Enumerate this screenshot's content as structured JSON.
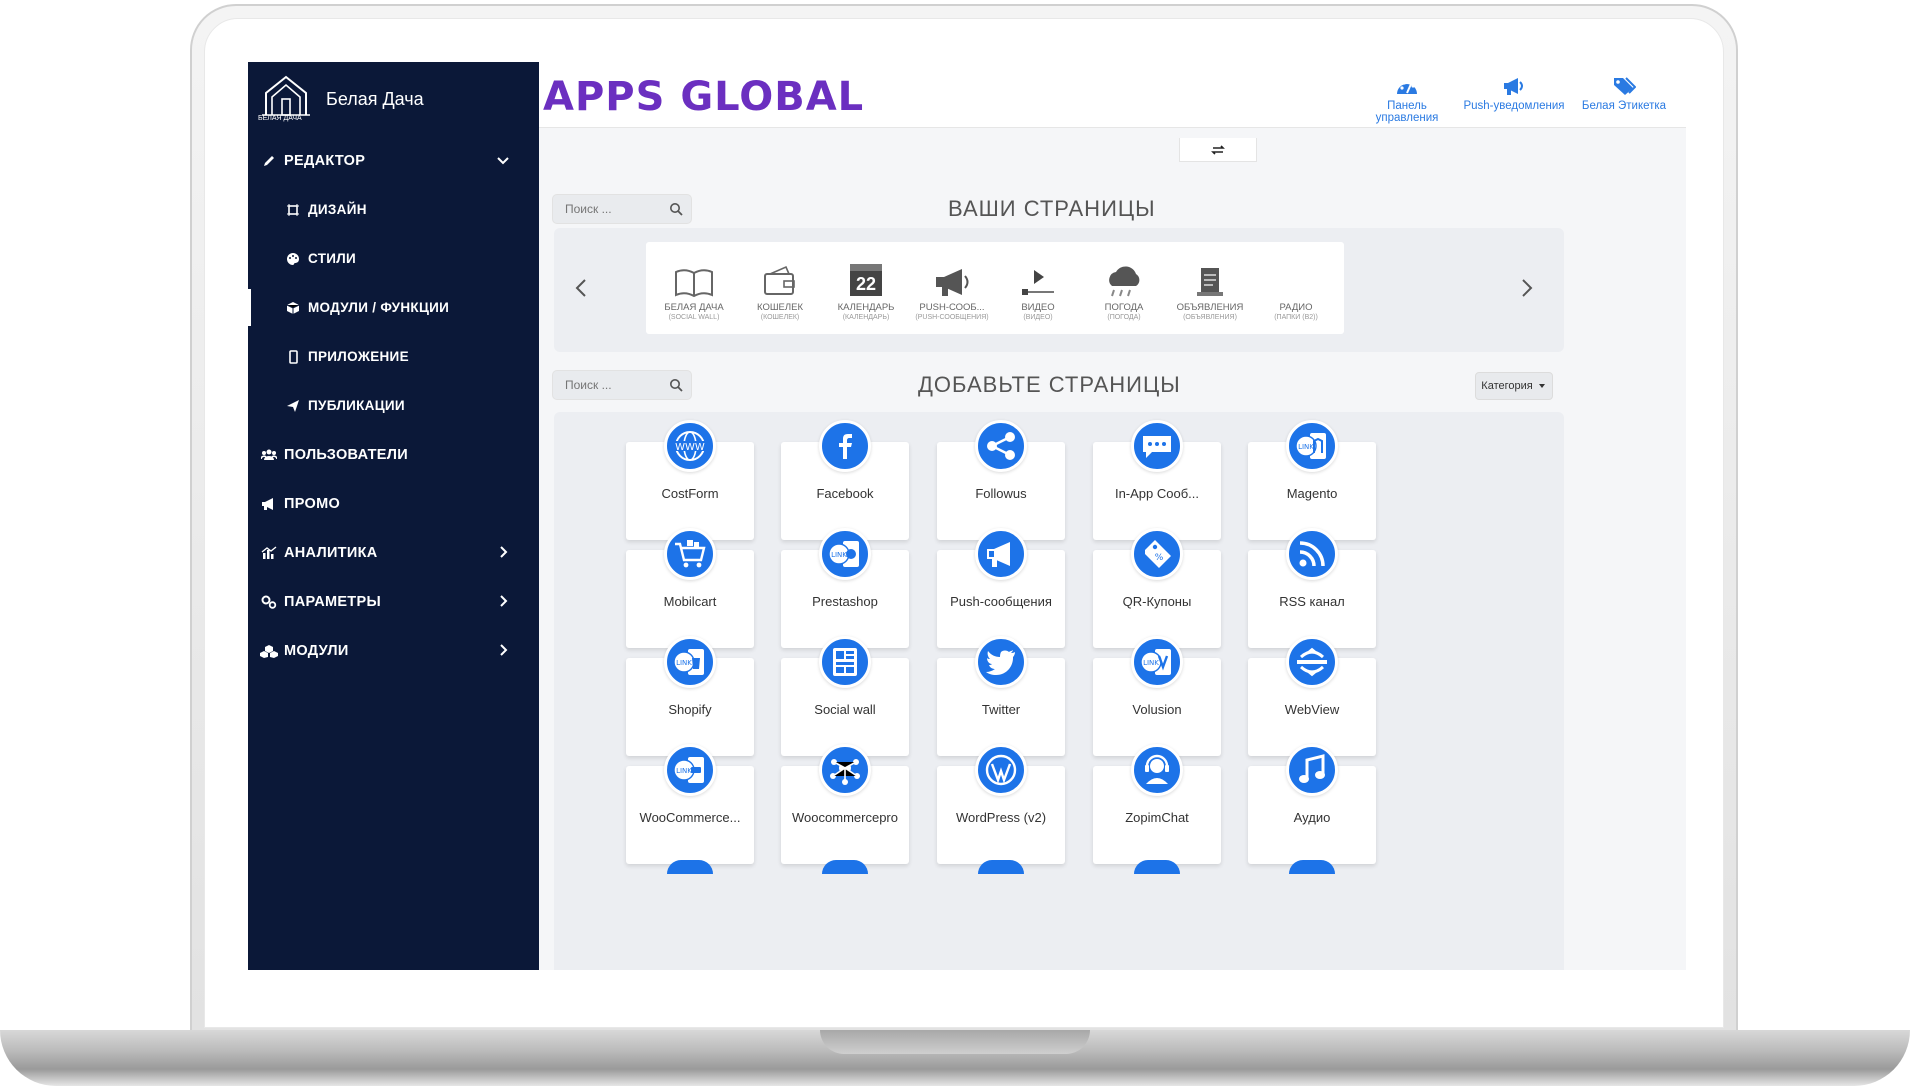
{
  "brand": {
    "name": "Белая Дача",
    "logo_sub": "БЕЛАЯ ДАЧА"
  },
  "sidebar": {
    "items": [
      {
        "label": "РЕДАКТОР",
        "icon": "pencil-icon",
        "level": 0,
        "chevron": "down"
      },
      {
        "label": "ДИЗАЙН",
        "icon": "design-icon",
        "level": 1
      },
      {
        "label": "СТИЛИ",
        "icon": "palette-icon",
        "level": 1
      },
      {
        "label": "МОДУЛИ / ФУНКЦИИ",
        "icon": "cube-icon",
        "level": 1,
        "active": true
      },
      {
        "label": "ПРИЛОЖЕНИЕ",
        "icon": "phone-icon",
        "level": 1
      },
      {
        "label": "ПУБЛИКАЦИИ",
        "icon": "send-icon",
        "level": 1
      },
      {
        "label": "ПОЛЬЗОВАТЕЛИ",
        "icon": "users-icon",
        "level": 0
      },
      {
        "label": "ПРОМО",
        "icon": "megaphone-icon",
        "level": 0
      },
      {
        "label": "АНАЛИТИКА",
        "icon": "chart-icon",
        "level": 0,
        "chevron": "right"
      },
      {
        "label": "ПАРАМЕТРЫ",
        "icon": "gears-icon",
        "level": 0,
        "chevron": "right"
      },
      {
        "label": "МОДУЛИ",
        "icon": "cubes-icon",
        "level": 0,
        "chevron": "right"
      }
    ]
  },
  "topbar": {
    "logo": "APPS GLOBAL",
    "actions": [
      {
        "label": "Панель управления",
        "icon": "dashboard-icon"
      },
      {
        "label": "Push-уведомления",
        "icon": "megaphone-icon"
      },
      {
        "label": "Белая Этикетка",
        "icon": "tags-icon"
      }
    ]
  },
  "your_pages": {
    "title": "ВАШИ СТРАНИЦЫ",
    "search_placeholder": "Поиск ...",
    "pages": [
      {
        "label": "БЕЛАЯ ДАЧА",
        "sub": "(SOCIAL WALL)",
        "icon": "book-icon"
      },
      {
        "label": "КОШЕЛЕК",
        "sub": "(КОШЕЛЕК)",
        "icon": "wallet-icon"
      },
      {
        "label": "КАЛЕНДАРЬ",
        "sub": "(КАЛЕНДАРЬ)",
        "icon": "calendar-icon",
        "calendar_day": "22"
      },
      {
        "label": "PUSH-СООБ...",
        "sub": "(PUSH-СООБЩЕНИЯ)",
        "icon": "megaphone-icon"
      },
      {
        "label": "ВИДЕО",
        "sub": "(ВИДЕО)",
        "icon": "video-icon"
      },
      {
        "label": "ПОГОДА",
        "sub": "(ПОГОДА)",
        "icon": "weather-icon"
      },
      {
        "label": "ОБЪЯВЛЕНИЯ",
        "sub": "(ОБЪЯВЛЕНИЯ)",
        "icon": "note-icon"
      },
      {
        "label": "РАДИО",
        "sub": "(ПАПКИ (B2))",
        "icon": "radio-icon"
      }
    ]
  },
  "add_pages": {
    "title": "ДОБАВЬТЕ СТРАНИЦЫ",
    "search_placeholder": "Поиск ...",
    "category_label": "Категория",
    "modules": [
      {
        "label": "CostForm",
        "icon": "www-icon"
      },
      {
        "label": "Facebook",
        "icon": "facebook-icon"
      },
      {
        "label": "Followus",
        "icon": "share-icon"
      },
      {
        "label": "In-App Cooб...",
        "icon": "chat-icon"
      },
      {
        "label": "Magento",
        "icon": "magento-icon"
      },
      {
        "label": "Mobilcart",
        "icon": "cart-icon"
      },
      {
        "label": "Prestashop",
        "icon": "prestashop-icon"
      },
      {
        "label": "Push-сообщения",
        "icon": "megaphone-icon"
      },
      {
        "label": "QR-Купоны",
        "icon": "coupon-icon"
      },
      {
        "label": "RSS канал",
        "icon": "rss-icon"
      },
      {
        "label": "Shopify",
        "icon": "shopify-icon"
      },
      {
        "label": "Social wall",
        "icon": "social-wall-icon"
      },
      {
        "label": "Twitter",
        "icon": "twitter-icon"
      },
      {
        "label": "Volusion",
        "icon": "volusion-icon"
      },
      {
        "label": "WebView",
        "icon": "webview-icon"
      },
      {
        "label": "WooCommerce...",
        "icon": "woocommerce-icon"
      },
      {
        "label": "Woocommercepro",
        "icon": "woocommercepro-icon"
      },
      {
        "label": "WordPress (v2)",
        "icon": "wordpress-icon"
      },
      {
        "label": "ZopimChat",
        "icon": "support-icon"
      },
      {
        "label": "Аудио",
        "icon": "music-icon"
      }
    ]
  },
  "colors": {
    "sidebar": "#0b1838",
    "accent": "#1d73e8",
    "logo": "#6b2fc0",
    "top_links": "#2a7ae2"
  }
}
